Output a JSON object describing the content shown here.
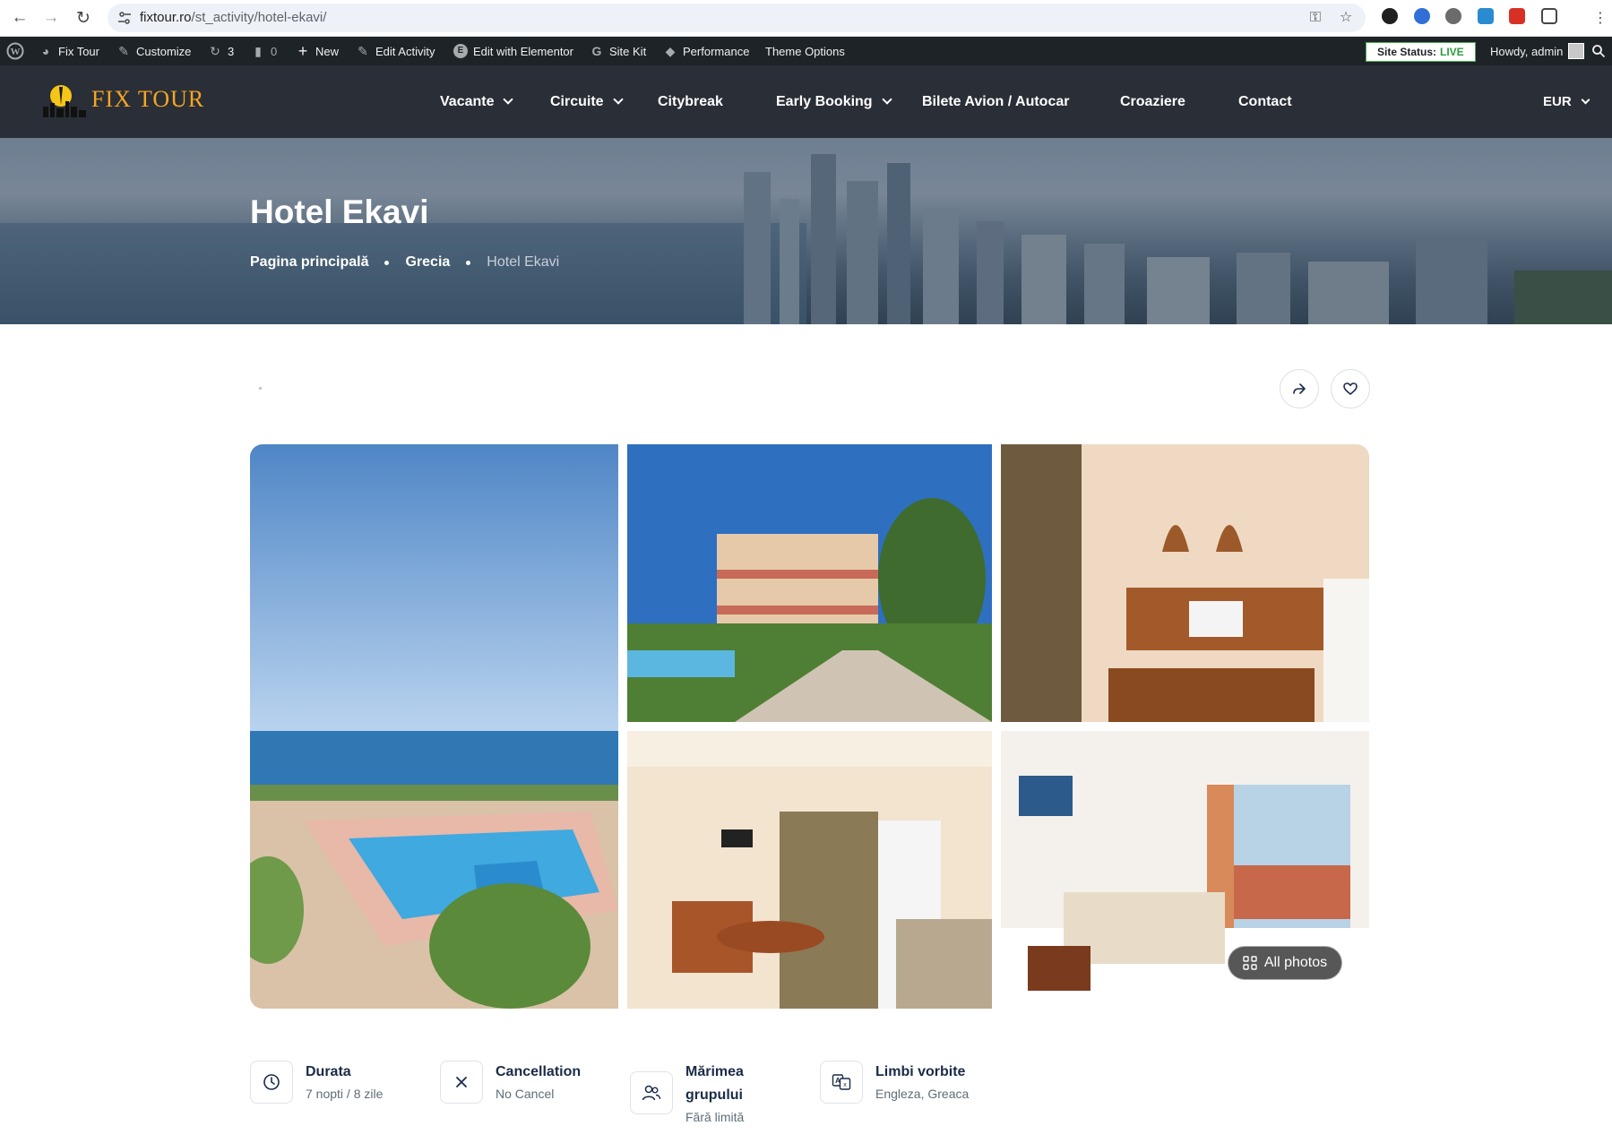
{
  "browser": {
    "url_host": "fixtour.ro",
    "url_path": "/st_activity/hotel-ekavi/"
  },
  "admin_bar": {
    "site_name": "Fix Tour",
    "customize": "Customize",
    "updates_count": "3",
    "comments_count": "0",
    "new": "New",
    "edit_activity": "Edit Activity",
    "edit_elementor": "Edit with Elementor",
    "site_kit": "Site Kit",
    "performance": "Performance",
    "theme_options": "Theme Options",
    "site_status_label": "Site Status:",
    "site_status_value": "LIVE",
    "howdy": "Howdy, admin"
  },
  "header": {
    "logo_text": "FIX TOUR",
    "menu": [
      {
        "label": "Vacante",
        "dropdown": true
      },
      {
        "label": "Circuite",
        "dropdown": true
      },
      {
        "label": "Citybreak",
        "dropdown": false
      },
      {
        "label": "Early Booking",
        "dropdown": true
      },
      {
        "label": "Bilete Avion / Autocar",
        "dropdown": false
      },
      {
        "label": "Croaziere",
        "dropdown": false
      },
      {
        "label": "Contact",
        "dropdown": false
      }
    ],
    "currency": "EUR"
  },
  "hero": {
    "title": "Hotel Ekavi",
    "breadcrumbs": [
      "Pagina principală",
      "Grecia",
      "Hotel Ekavi"
    ]
  },
  "gallery": {
    "all_photos_label": "All photos"
  },
  "info": [
    {
      "icon": "clock-icon",
      "title": "Durata",
      "value": "7 nopti / 8 zile"
    },
    {
      "icon": "close-icon",
      "title": "Cancellation",
      "value": "No Cancel"
    },
    {
      "icon": "users-icon",
      "title": "Mărimea grupului",
      "value": "Fără limită"
    },
    {
      "icon": "translate-icon",
      "title": "Limbi vorbite",
      "value": "Engleza, Greaca"
    }
  ],
  "colors": {
    "header_bg": "#2a2e36",
    "admin_bar_bg": "#1d2327",
    "logo_color": "#f5a623",
    "status_live": "#2e9b3b"
  }
}
